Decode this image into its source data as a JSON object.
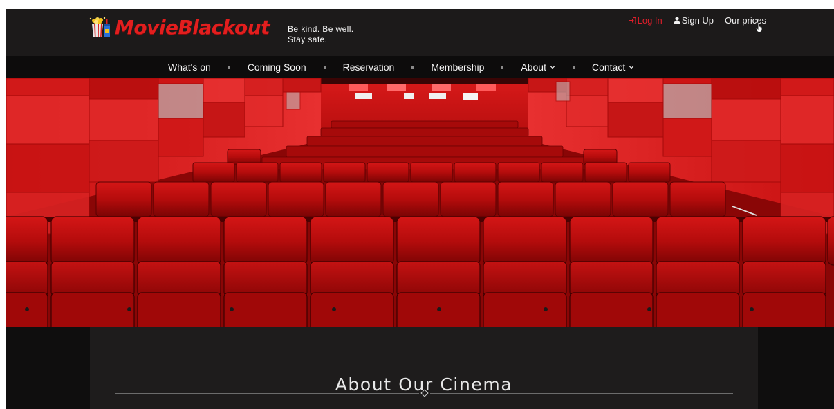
{
  "brand": {
    "name": "MovieBlackout",
    "tagline_line1": "Be kind. Be well.",
    "tagline_line2": "Stay safe.",
    "color": "#e21e1e"
  },
  "top_links": {
    "login": "Log In",
    "signup": "Sign Up",
    "prices": "Our prices"
  },
  "nav": {
    "items": [
      {
        "label": "What's on",
        "dropdown": false
      },
      {
        "label": "Coming Soon",
        "dropdown": false
      },
      {
        "label": "Reservation",
        "dropdown": false
      },
      {
        "label": "Membership",
        "dropdown": false
      },
      {
        "label": "About",
        "dropdown": true
      },
      {
        "label": "Contact",
        "dropdown": true
      }
    ]
  },
  "about": {
    "title": "About Our Cinema"
  },
  "colors": {
    "accent": "#e01e2a",
    "header_bg": "#1c1a1a",
    "nav_bg": "#0d0c0c",
    "section_bg": "#1e1c1c"
  }
}
